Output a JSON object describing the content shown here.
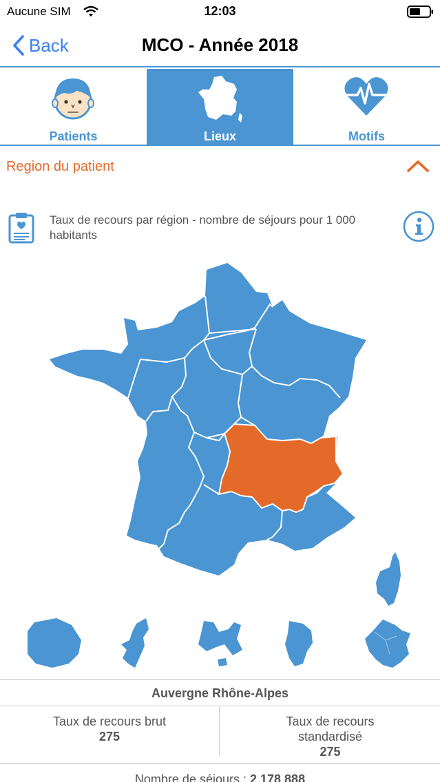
{
  "status": {
    "carrier": "Aucune SIM",
    "time": "12:03"
  },
  "nav": {
    "back_label": "Back",
    "title": "MCO - Année 2018"
  },
  "tabs": [
    {
      "label": "Patients",
      "icon": "patient-face-icon",
      "active": false
    },
    {
      "label": "Lieux",
      "icon": "france-map-icon",
      "active": true
    },
    {
      "label": "Motifs",
      "icon": "heart-pulse-icon",
      "active": false
    }
  ],
  "section": {
    "title": "Region du patient"
  },
  "indicator": {
    "text": "Taux de recours par région  - nombre de séjours pour 1 000 habitants"
  },
  "map": {
    "selected_region": "Auvergne Rhône-Alpes",
    "colors": {
      "region": "#4a95d2",
      "selected": "#e46a2a",
      "accent": "#4a95d2",
      "section_title": "#e46a2a"
    },
    "overseas": [
      "reunion-shape",
      "mayotte-shape",
      "guadeloupe-shape",
      "martinique-shape",
      "guyane-shape"
    ]
  },
  "result": {
    "region_name": "Auvergne Rhône-Alpes",
    "brut": {
      "label": "Taux de recours brut",
      "value": "275"
    },
    "standardise": {
      "label": "Taux de recours standardisé",
      "value": "275"
    },
    "sejours_label": "Nombre de séjours :",
    "sejours_value": "2 178 888"
  }
}
